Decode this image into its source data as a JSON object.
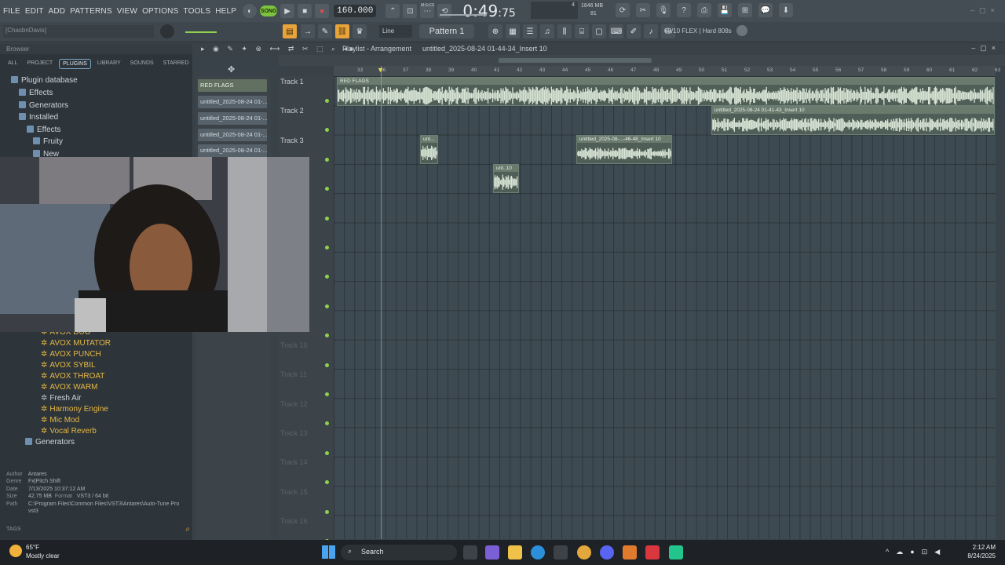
{
  "menu": [
    "FILE",
    "EDIT",
    "ADD",
    "PATTERNS",
    "VIEW",
    "OPTIONS",
    "TOOLS",
    "HELP"
  ],
  "transport": {
    "mode": "SONG",
    "tempo": "160.000",
    "time_main": "0:49",
    "time_sub": "75",
    "time_unit": "M:S:CS"
  },
  "monitor": {
    "memory": "1846 MB",
    "cpu": "4",
    "polyphony": "81"
  },
  "user_tag": "[ChasbnDavis]",
  "snap": "Line",
  "pattern": "Pattern 1",
  "flex": "08/10 FLEX | Hard 808s",
  "browser": {
    "title": "Browser",
    "tabs": [
      "ALL",
      "PROJECT",
      "PLUGINS",
      "LIBRARY",
      "SOUNDS",
      "STARRED"
    ],
    "active_tab": "PLUGINS",
    "tree": [
      "Plugin database",
      "Effects",
      "Generators",
      "Installed",
      "Effects",
      "Fruity",
      "New"
    ],
    "plugins": [
      "AVOX DUO",
      "AVOX MUTATOR",
      "AVOX PUNCH",
      "AVOX SYBIL",
      "AVOX THROAT",
      "AVOX WARM",
      "Fresh Air",
      "Harmony Engine",
      "Mic Mod",
      "Vocal Reverb"
    ],
    "generators": "Generators",
    "info": {
      "author_k": "Author",
      "author_v": "Antares",
      "genre_k": "Genre",
      "genre_v": "Fx|Pitch Shift",
      "date_k": "Date",
      "date_v": "7/13/2025 10:37:12 AM",
      "size_k": "Size",
      "size_v": "42.75 MB",
      "format_k": "Format",
      "format_v": "VST3 / 64 bit",
      "path_k": "Path",
      "path_v": "C:\\Program Files\\Common Files\\VST3\\Antares\\Auto-Tune Pro vst3"
    },
    "tags": "TAGS"
  },
  "channels": [
    "RED FLAGS",
    "untitled_2025-08-24 01-...",
    "untitled_2025-08-24 01-...",
    "untitled_2025-08-24 01-...",
    "untitled_2025-08-24 01-..."
  ],
  "playlist": {
    "title": "Playlist - Arrangement",
    "breadcrumb": "untitled_2025-08-24 01-44-34_Insert 10",
    "ruler": [
      "33",
      "36",
      "37",
      "38",
      "39",
      "40",
      "41",
      "42",
      "43",
      "44",
      "45",
      "46",
      "47",
      "48",
      "49",
      "50",
      "51",
      "52",
      "53",
      "54",
      "55",
      "56",
      "57",
      "58",
      "59",
      "60",
      "61",
      "62",
      "63"
    ],
    "tracks": [
      "Track 1",
      "Track 2",
      "Track 3",
      "Track 10",
      "Track 11",
      "Track 12",
      "Track 13",
      "Track 14",
      "Track 15",
      "Track 16"
    ],
    "clips": {
      "t1": "RED FLAGS",
      "t2": "untitled_2025-08-24 01-41-43_Insert 10",
      "t3a": "unt...",
      "t3b": "untitled_2025-08-...-46-48_Insert 10",
      "t4": "unt..10"
    }
  },
  "taskbar": {
    "temp": "65°F",
    "weather": "Mostly clear",
    "search": "Search",
    "time": "2:12 AM",
    "date": "8/24/2025"
  },
  "colors": {
    "accent_green": "#8fd14f",
    "plugin_gold": "#e5b744",
    "clip_bg": "#4f5e56",
    "grid_bg": "#3e4a52"
  }
}
